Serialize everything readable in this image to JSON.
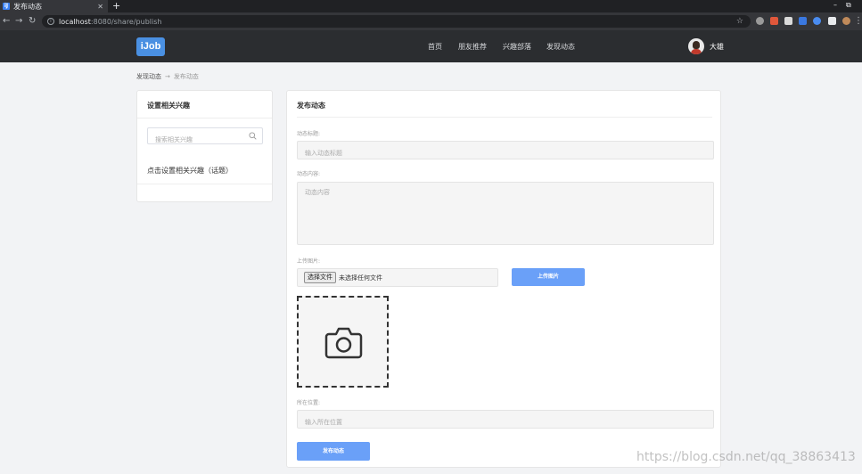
{
  "browser": {
    "tab_favicon": "iJ",
    "tab_title": "发布动态",
    "url_host": "localhost",
    "url_rest": ":8080/share/publish"
  },
  "header": {
    "logo": "iJob",
    "nav": [
      "首页",
      "朋友推荐",
      "兴趣部落",
      "发现动态"
    ],
    "username": "大雄"
  },
  "breadcrumb": {
    "parent": "发现动态",
    "separator": "→",
    "current": "发布动态"
  },
  "left_card": {
    "title": "设置相关兴趣",
    "search_placeholder": "搜索相关兴趣",
    "topic_link": "点击设置相关兴趣（话题）"
  },
  "publish_form": {
    "title": "发布动态",
    "title_label": "动态标题:",
    "title_placeholder": "输入动态标题",
    "content_label": "动态内容:",
    "content_placeholder": "动态内容",
    "image_label": "上传图片:",
    "file_button": "选择文件",
    "file_status": "未选择任何文件",
    "upload_button": "上传图片",
    "location_label": "所在位置:",
    "location_placeholder": "输入所在位置",
    "submit_button": "发布动态"
  },
  "watermark": "https://blog.csdn.net/qq_38863413",
  "colors": {
    "header_bg": "#2b2d30",
    "accent": "#6aa0f8",
    "logo_bg": "#4a90e2"
  }
}
